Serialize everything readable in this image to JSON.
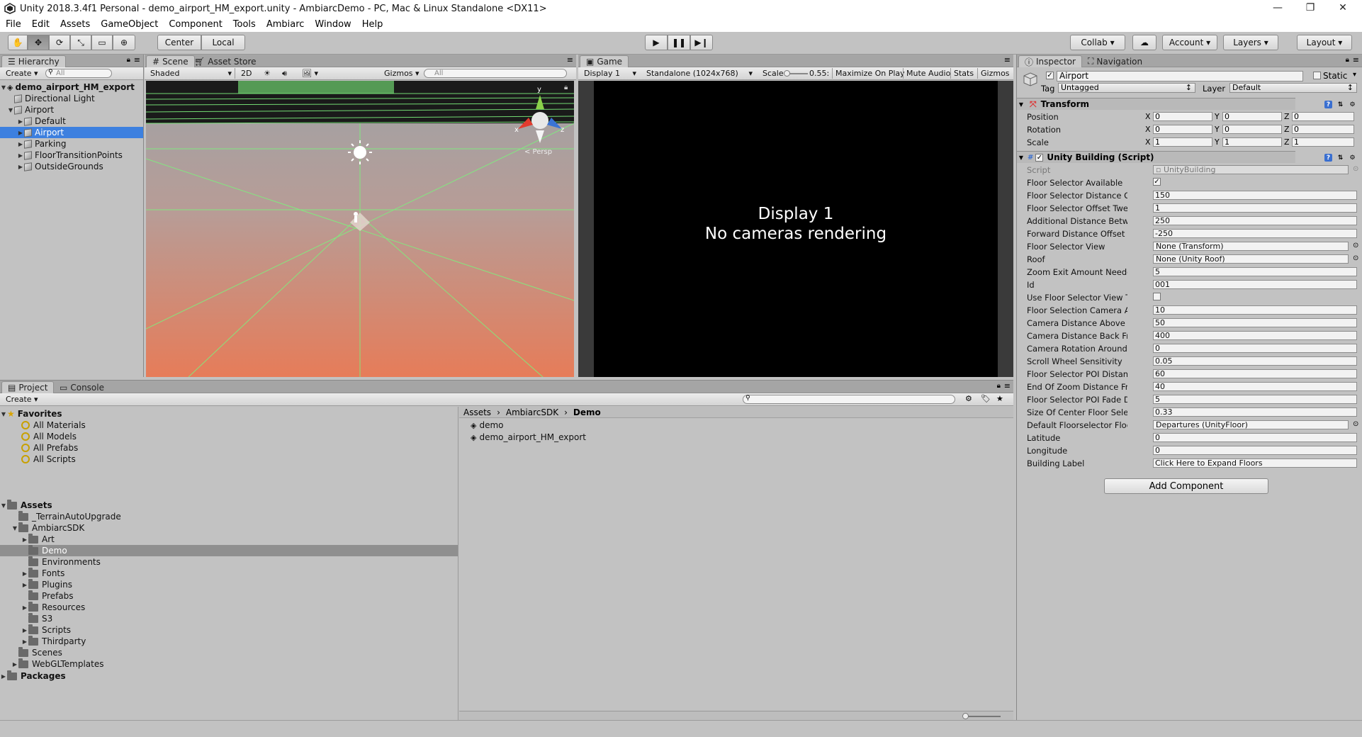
{
  "window": {
    "title": "Unity 2018.3.4f1 Personal - demo_airport_HM_export.unity - AmbiarcDemo - PC, Mac & Linux Standalone <DX11>",
    "minimize": "—",
    "maximize": "❐",
    "close": "✕"
  },
  "menu": [
    "File",
    "Edit",
    "Assets",
    "GameObject",
    "Component",
    "Tools",
    "Ambiarc",
    "Window",
    "Help"
  ],
  "toolbar": {
    "tools": [
      "hand-icon",
      "move-icon",
      "rotate-icon",
      "scale-icon",
      "rect-icon",
      "transform-icon"
    ],
    "pivot": "Center",
    "space": "Local",
    "collab": "Collab",
    "account": "Account",
    "layers": "Layers",
    "layout": "Layout"
  },
  "hierarchy": {
    "tab": "Hierarchy",
    "create": "Create",
    "search_placeholder": "All",
    "scene": "demo_airport_HM_export",
    "items": [
      {
        "label": "Directional Light",
        "indent": 1,
        "arrow": ""
      },
      {
        "label": "Airport",
        "indent": 1,
        "arrow": "▼"
      },
      {
        "label": "Default",
        "indent": 2,
        "arrow": "▶"
      },
      {
        "label": "Airport",
        "indent": 2,
        "arrow": "▶",
        "selected": true
      },
      {
        "label": "Parking",
        "indent": 2,
        "arrow": "▶"
      },
      {
        "label": "FloorTransitionPoints",
        "indent": 2,
        "arrow": "▶"
      },
      {
        "label": "OutsideGrounds",
        "indent": 2,
        "arrow": "▶"
      }
    ]
  },
  "scene": {
    "tabs": [
      "Scene",
      "Asset Store"
    ],
    "shading": "Shaded",
    "mode2d": "2D",
    "gizmos": "Gizmos",
    "search_placeholder": "All",
    "persp": "< Persp",
    "gizmo_axes": {
      "y": "y",
      "x": "x",
      "z": "z"
    }
  },
  "game": {
    "tab": "Game",
    "display": "Display 1",
    "resolution": "Standalone (1024x768)",
    "scale_label": "Scale",
    "scale_value": "0.55:",
    "maximize": "Maximize On Play",
    "mute": "Mute Audio",
    "stats": "Stats",
    "gizmos": "Gizmos",
    "message_line1": "Display 1",
    "message_line2": "No cameras rendering"
  },
  "project": {
    "tabs": [
      "Project",
      "Console"
    ],
    "create": "Create",
    "favorites_label": "Favorites",
    "favorites": [
      "All Materials",
      "All Models",
      "All Prefabs",
      "All Scripts"
    ],
    "assets_label": "Assets",
    "tree": [
      {
        "label": "_TerrainAutoUpgrade",
        "indent": 1,
        "arrow": ""
      },
      {
        "label": "AmbiarcSDK",
        "indent": 1,
        "arrow": "▼"
      },
      {
        "label": "Art",
        "indent": 2,
        "arrow": "▶"
      },
      {
        "label": "Demo",
        "indent": 2,
        "arrow": "",
        "selected": true
      },
      {
        "label": "Environments",
        "indent": 2,
        "arrow": ""
      },
      {
        "label": "Fonts",
        "indent": 2,
        "arrow": "▶"
      },
      {
        "label": "Plugins",
        "indent": 2,
        "arrow": "▶"
      },
      {
        "label": "Prefabs",
        "indent": 2,
        "arrow": ""
      },
      {
        "label": "Resources",
        "indent": 2,
        "arrow": "▶"
      },
      {
        "label": "S3",
        "indent": 2,
        "arrow": ""
      },
      {
        "label": "Scripts",
        "indent": 2,
        "arrow": "▶"
      },
      {
        "label": "Thirdparty",
        "indent": 2,
        "arrow": "▶"
      },
      {
        "label": "Scenes",
        "indent": 1,
        "arrow": ""
      },
      {
        "label": "WebGLTemplates",
        "indent": 1,
        "arrow": "▶"
      }
    ],
    "packages_label": "Packages",
    "breadcrumb": [
      "Assets",
      "AmbiarcSDK",
      "Demo"
    ],
    "files": [
      "demo",
      "demo_airport_HM_export"
    ]
  },
  "inspector": {
    "tabs": [
      "Inspector",
      "Navigation"
    ],
    "object_name": "Airport",
    "static_label": "Static",
    "tag_label": "Tag",
    "tag_value": "Untagged",
    "layer_label": "Layer",
    "layer_value": "Default",
    "transform": {
      "title": "Transform",
      "rows": [
        {
          "label": "Position",
          "x": "0",
          "y": "0",
          "z": "0"
        },
        {
          "label": "Rotation",
          "x": "0",
          "y": "0",
          "z": "0"
        },
        {
          "label": "Scale",
          "x": "1",
          "y": "1",
          "z": "1"
        }
      ]
    },
    "script_component": {
      "title": "Unity Building (Script)",
      "script_label": "Script",
      "script_value": "UnityBuilding",
      "fields": [
        {
          "label": "Floor Selector Available",
          "type": "check",
          "value": "✓"
        },
        {
          "label": "Floor Selector Distance Offset",
          "type": "text",
          "value": "150"
        },
        {
          "label": "Floor Selector Offset Tween Le",
          "type": "text",
          "value": "1"
        },
        {
          "label": "Additional Distance Between Fl",
          "type": "text",
          "value": "250"
        },
        {
          "label": "Forward Distance Offset Betwe",
          "type": "text",
          "value": "-250"
        },
        {
          "label": "Floor Selector View",
          "type": "obj",
          "value": "None (Transform)"
        },
        {
          "label": "Roof",
          "type": "obj",
          "value": "None (Unity Roof)"
        },
        {
          "label": "Zoom Exit Amount Needed",
          "type": "text",
          "value": "5"
        },
        {
          "label": "Id",
          "type": "text",
          "value": "001"
        },
        {
          "label": "Use Floor Selector View Transf",
          "type": "check",
          "value": ""
        },
        {
          "label": "Floor Selection Camera Angle",
          "type": "text",
          "value": "10"
        },
        {
          "label": "Camera Distance Above Cente",
          "type": "text",
          "value": "50"
        },
        {
          "label": "Camera Distance Back From C",
          "type": "text",
          "value": "400"
        },
        {
          "label": "Camera Rotation Around Cente",
          "type": "text",
          "value": "0"
        },
        {
          "label": "Scroll Wheel Sensitivity",
          "type": "text",
          "value": "0.05"
        },
        {
          "label": "Floor Selector POI Distance Off",
          "type": "text",
          "value": "60"
        },
        {
          "label": "End Of Zoom Distance From To",
          "type": "text",
          "value": "40"
        },
        {
          "label": "Floor Selector POI Fade Distan",
          "type": "text",
          "value": "5"
        },
        {
          "label": "Size Of Center Floor Selector S",
          "type": "text",
          "value": "0.33"
        },
        {
          "label": "Default Floorselector Floor",
          "type": "obj",
          "value": "Departures (UnityFloor)"
        },
        {
          "label": "Latitude",
          "type": "text",
          "value": "0"
        },
        {
          "label": "Longitude",
          "type": "text",
          "value": "0"
        },
        {
          "label": "Building Label",
          "type": "text",
          "value": "Click Here to Expand Floors"
        }
      ]
    },
    "add_component": "Add Component"
  },
  "colors": {
    "selection": "#3d80df",
    "panel_bg": "#c2c2c2",
    "tab_bg": "#a5a5a5"
  }
}
